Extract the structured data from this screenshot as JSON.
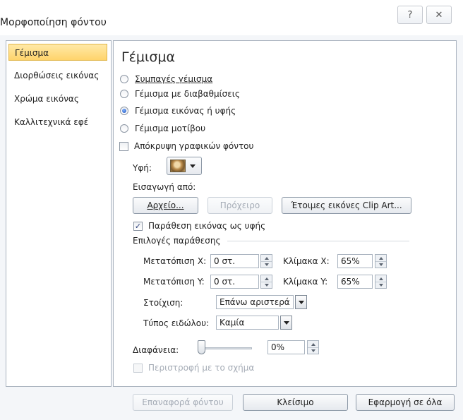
{
  "window": {
    "title": "Μορφοποίηση φόντου",
    "help_icon": "question-mark-icon",
    "close_icon": "close-icon"
  },
  "sidebar": {
    "items": [
      {
        "label": "Γέμισμα",
        "selected": true
      },
      {
        "label": "Διορθώσεις εικόνας",
        "selected": false
      },
      {
        "label": "Χρώμα εικόνας",
        "selected": false
      },
      {
        "label": "Καλλιτεχνικά εφέ",
        "selected": false
      }
    ]
  },
  "fill": {
    "heading": "Γέμισμα",
    "options": [
      {
        "label": "Συμπαγές γέμισμα",
        "selected": false
      },
      {
        "label": "Γέμισμα με διαβαθμίσεις",
        "selected": false
      },
      {
        "label": "Γέμισμα εικόνας ή υφής",
        "selected": true
      },
      {
        "label": "Γέμισμα μοτίβου",
        "selected": false
      }
    ],
    "hide_graphics": {
      "label": "Απόκρυψη γραφικών φόντου",
      "checked": false
    },
    "texture_label": "Υφή:",
    "insert_from_label": "Εισαγωγή από:",
    "buttons": {
      "file": "Αρχείο...",
      "clipboard": "Πρόχειρο",
      "clipart": "Έτοιμες εικόνες Clip Art..."
    },
    "tile_checkbox": {
      "label": "Παράθεση εικόνας ως υφής",
      "checked": true
    },
    "tiling_options_label": "Επιλογές παράθεσης",
    "offset_x": {
      "label": "Μετατόπιση X:",
      "value": "0 στ."
    },
    "offset_y": {
      "label": "Μετατόπιση Y:",
      "value": "0 στ."
    },
    "scale_x": {
      "label": "Κλίμακα X:",
      "value": "65%"
    },
    "scale_y": {
      "label": "Κλίμακα Y:",
      "value": "65%"
    },
    "alignment": {
      "label": "Στοίχιση:",
      "value": "Επάνω αριστερά"
    },
    "mirror_type": {
      "label": "Τύπος ειδώλου:",
      "value": "Καμία"
    },
    "transparency": {
      "label": "Διαφάνεια:",
      "value": "0%",
      "level": 0
    },
    "rotate_with_shape": {
      "label": "Περιστροφή με το σχήμα",
      "checked": false,
      "disabled": true
    }
  },
  "footer": {
    "reset": "Επαναφορά φόντου",
    "close": "Κλείσιμο",
    "apply_all": "Εφαρμογή σε όλα"
  }
}
